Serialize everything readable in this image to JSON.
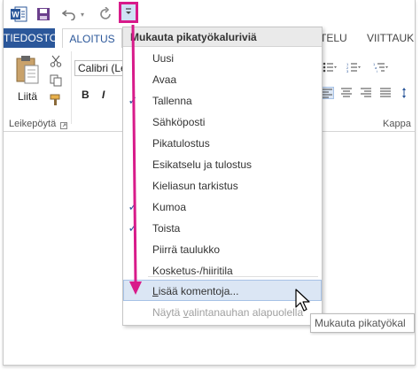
{
  "qat": {
    "app_icon": "word-icon",
    "save_icon": "save-icon",
    "undo_icon": "undo-icon",
    "redo_icon": "redo-icon",
    "customize_icon": "chevron-down-icon"
  },
  "tabs": {
    "file": "TIEDOSTO",
    "home": "ALOITUS",
    "design_partial": "TELU",
    "references": "VIITTAUK"
  },
  "ribbon": {
    "paste_label": "Liitä",
    "font_name": "Calibri (Le",
    "bold": "B",
    "italic": "I",
    "clipboard_group": "Leikepöytä",
    "paragraph_group": "Kappa"
  },
  "menu": {
    "header": "Mukauta pikatyökaluriviä",
    "items": [
      {
        "label": "Uusi",
        "checked": false
      },
      {
        "label": "Avaa",
        "checked": false
      },
      {
        "label": "Tallenna",
        "checked": true
      },
      {
        "label": "Sähköposti",
        "checked": false
      },
      {
        "label": "Pikatulostus",
        "checked": false
      },
      {
        "label": "Esikatselu ja tulostus",
        "checked": false
      },
      {
        "label": "Kieliasun tarkistus",
        "checked": false
      },
      {
        "label": "Kumoa",
        "checked": true
      },
      {
        "label": "Toista",
        "checked": true
      },
      {
        "label": "Piirrä taulukko",
        "checked": false
      },
      {
        "label": "Kosketus-/hiiritila",
        "checked": false
      }
    ],
    "more_commands": "Lisää komentoja...",
    "show_below": "Näytä valintanauhan alapuolella"
  },
  "tooltip": "Mukauta pikatyökal",
  "colors": {
    "accent": "#2b579a",
    "highlight_magenta": "#d81b8a",
    "menu_highlight": "#dbe6f4"
  }
}
